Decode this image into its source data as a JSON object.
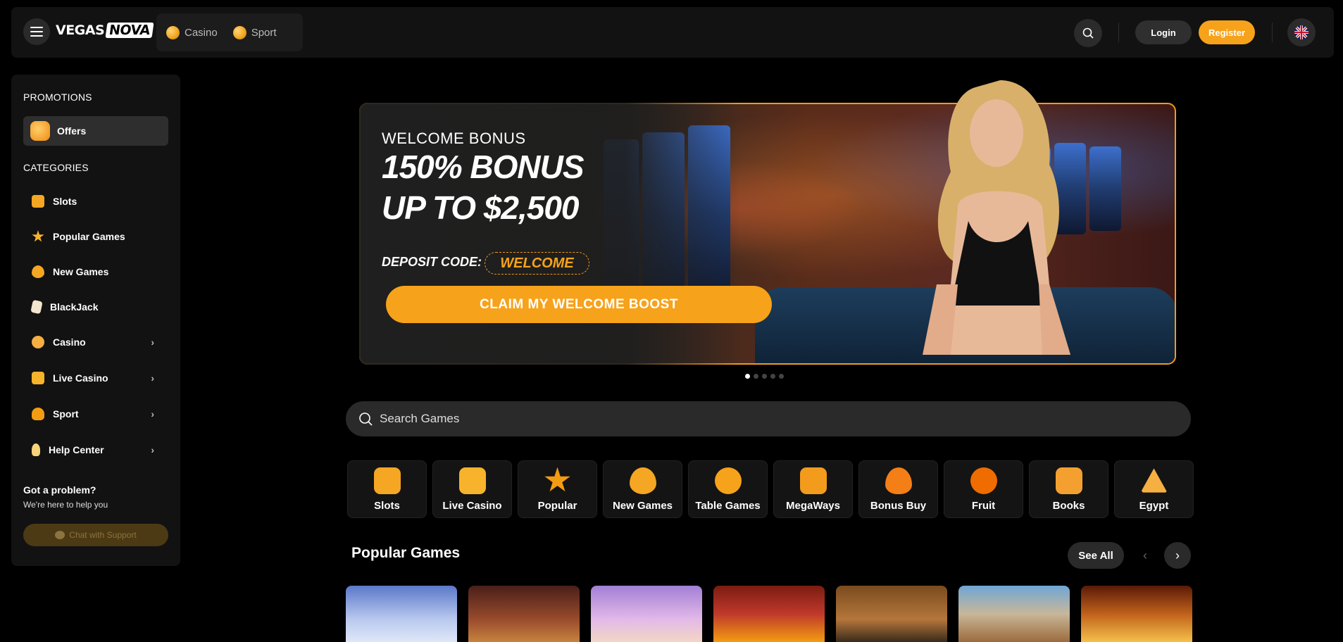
{
  "header": {
    "logo": {
      "part1": "VEGAS",
      "part2": "NOVA"
    },
    "modes": [
      {
        "label": "Casino",
        "icon": "casino-coin-icon"
      },
      {
        "label": "Sport",
        "icon": "sport-ball-icon"
      }
    ],
    "login_label": "Login",
    "register_label": "Register",
    "language_icon": "uk-flag-icon",
    "colors": {
      "accent": "#f7a21b",
      "bg": "#121212"
    }
  },
  "sidebar": {
    "promotions_title": "PROMOTIONS",
    "offers_label": "Offers",
    "categories_title": "CATEGORIES",
    "items": [
      {
        "label": "Slots",
        "icon": "slots-icon"
      },
      {
        "label": "Popular Games",
        "icon": "star-icon"
      },
      {
        "label": "New Games",
        "icon": "heart-icon"
      },
      {
        "label": "BlackJack",
        "icon": "card-icon"
      },
      {
        "label": "Casino",
        "icon": "casino-chip-icon"
      },
      {
        "label": "Live Casino",
        "icon": "live-casino-icon"
      },
      {
        "label": "Sport",
        "icon": "sport-icon"
      },
      {
        "label": "Help Center",
        "icon": "bulb-icon"
      }
    ],
    "problem_title": "Got a problem?",
    "problem_sub": "We're here to help you",
    "chat_label": "Chat with Support"
  },
  "hero": {
    "eyebrow": "WELCOME BONUS",
    "line1": "150% BONUS",
    "line2": "UP TO $2,500",
    "deposit_label": "DEPOSIT CODE:",
    "code": "WELCOME",
    "cta": "CLAIM MY WELCOME BOOST",
    "slides": 5,
    "active_slide": 1
  },
  "search": {
    "placeholder": "Search Games"
  },
  "game_categories": [
    {
      "label": "Slots",
      "color": "#f5a623"
    },
    {
      "label": "Live Casino",
      "color": "#f7b32b"
    },
    {
      "label": "Popular",
      "color": "#f39c12"
    },
    {
      "label": "New Games",
      "color": "#f5a623"
    },
    {
      "label": "Table Games",
      "color": "#f7a21b"
    },
    {
      "label": "MegaWays",
      "color": "#f29b1d"
    },
    {
      "label": "Bonus Buy",
      "color": "#f57f17"
    },
    {
      "label": "Fruit",
      "color": "#ef6c00"
    },
    {
      "label": "Books",
      "color": "#f4a030"
    },
    {
      "label": "Egypt",
      "color": "#f5b041"
    }
  ],
  "popular": {
    "title": "Popular Games",
    "see_all": "See All"
  }
}
